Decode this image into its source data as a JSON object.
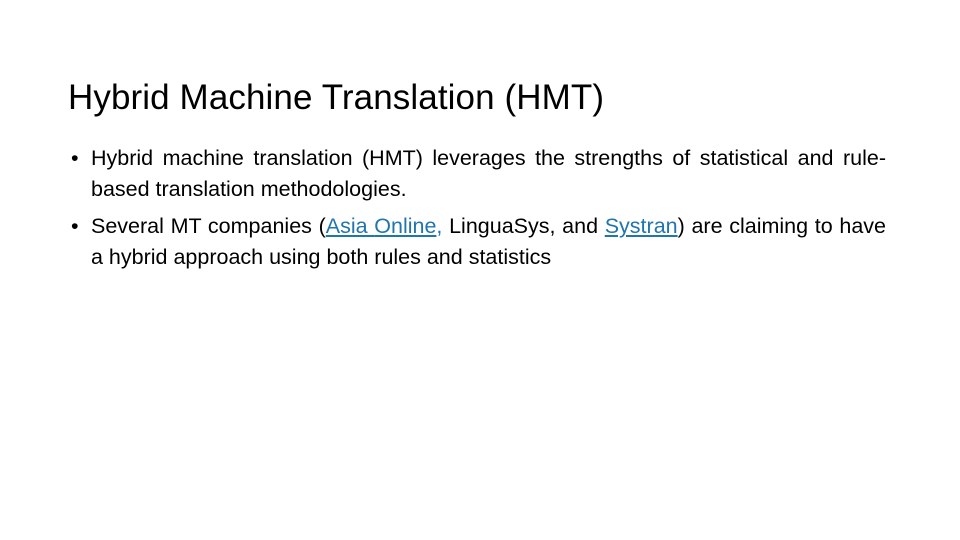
{
  "slide": {
    "title": "Hybrid Machine Translation (HMT)",
    "background_color": "#FFFFFF",
    "text_color": "#000000",
    "link_color": "#2175AD",
    "bullet_marker": "•",
    "bullets": [
      {
        "id": "bullet-hmt-definition",
        "segments": [
          {
            "type": "text",
            "value": "Hybrid machine translation (HMT) leverages the strengths of statistical and rule-based translation methodologies."
          }
        ],
        "plain_text": "Hybrid machine translation (HMT) leverages the strengths of statistical and rule-based translation methodologies."
      },
      {
        "id": "bullet-mt-companies",
        "segments": [
          {
            "type": "text",
            "value": "Several MT companies ("
          },
          {
            "type": "link",
            "value": "Asia "
          },
          {
            "type": "link",
            "value": "Online"
          },
          {
            "type": "link-punct",
            "value": ","
          },
          {
            "type": "text",
            "value": " LinguaSys, and "
          },
          {
            "type": "link",
            "value": "Systran"
          },
          {
            "type": "text",
            "value": ") are claiming to have a hybrid approach using both rules and statistics"
          }
        ],
        "plain_text": "Several MT companies (Asia Online, LinguaSys, and Systran) are claiming to have a hybrid approach using both rules and statistics"
      }
    ]
  }
}
